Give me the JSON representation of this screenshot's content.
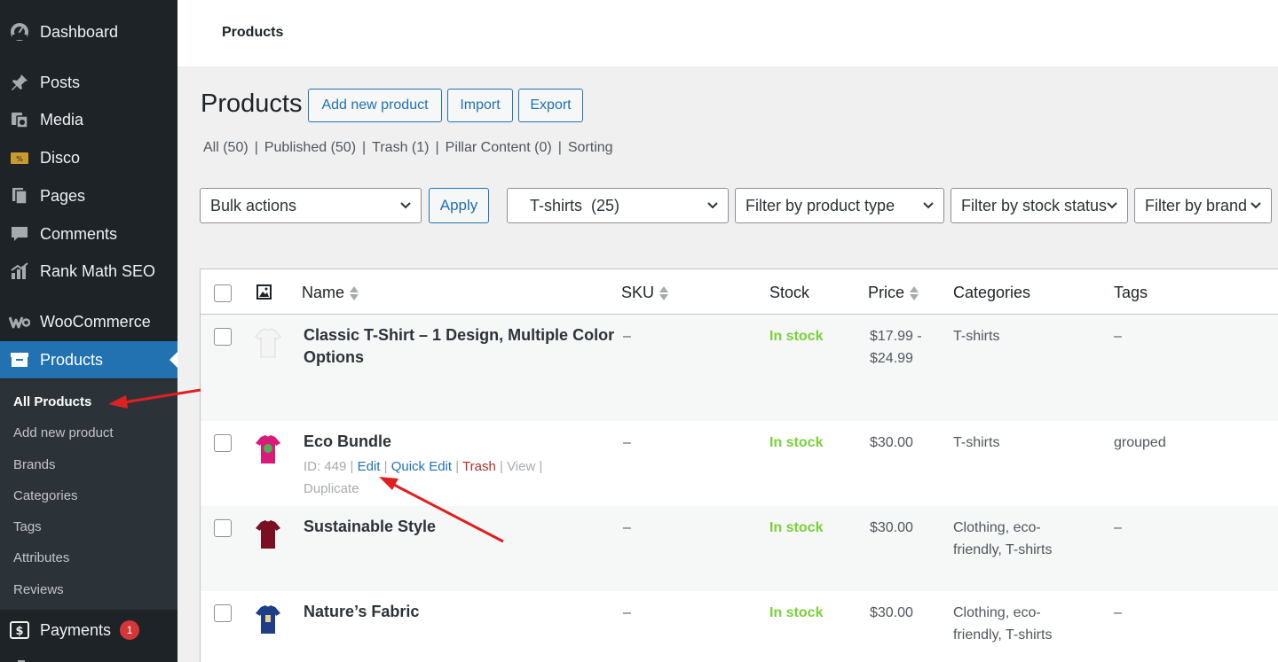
{
  "sidebar": {
    "menu": [
      {
        "label": "Dashboard",
        "icon": "dashboard-icon"
      },
      {
        "label": "Posts",
        "icon": "pin-icon"
      },
      {
        "label": "Media",
        "icon": "media-icon"
      },
      {
        "label": "Disco",
        "icon": "disco-icon"
      },
      {
        "label": "Pages",
        "icon": "pages-icon"
      },
      {
        "label": "Comments",
        "icon": "comment-icon"
      },
      {
        "label": "Rank Math SEO",
        "icon": "chart-icon"
      },
      {
        "label": "WooCommerce",
        "icon": "woo-icon"
      },
      {
        "label": "Products",
        "icon": "archive-icon"
      },
      {
        "label": "Payments",
        "icon": "dollar-icon",
        "badge": "1"
      }
    ],
    "submenu": [
      "All Products",
      "Add new product",
      "Brands",
      "Categories",
      "Tags",
      "Attributes",
      "Reviews"
    ]
  },
  "topbar": {
    "title": "Products"
  },
  "page": {
    "title": "Products",
    "buttons": {
      "add_new": "Add new product",
      "import": "Import",
      "export": "Export"
    },
    "views": [
      "All (50)",
      "Published (50)",
      "Trash (1)",
      "Pillar Content (0)",
      "Sorting"
    ]
  },
  "filters": {
    "bulk_actions": "Bulk actions",
    "apply": "Apply",
    "category": "T-shirts  (25)",
    "product_type": "Filter by product type",
    "stock_status": "Filter by stock status",
    "brand": "Filter by brand"
  },
  "table": {
    "columns": {
      "name": "Name",
      "sku": "SKU",
      "stock": "Stock",
      "price": "Price",
      "categories": "Categories",
      "tags": "Tags"
    },
    "rows": [
      {
        "name_line1": "Classic T-Shirt – 1 Design, Multiple Color",
        "name_line2": "Options",
        "sku": "–",
        "stock": "In stock",
        "price_line1": "$17.99 -",
        "price_line2": "$24.99",
        "cat_line1": "T-shirts",
        "cat_line2": "",
        "tags": "–",
        "shirt_color": "#f4f4f4"
      },
      {
        "name_line1": "Eco Bundle",
        "name_line2": "",
        "sku": "–",
        "stock": "In stock",
        "price_line1": "$30.00",
        "price_line2": "",
        "cat_line1": "T-shirts",
        "cat_line2": "",
        "tags": "grouped",
        "shirt_color": "#d81b7a",
        "actions": {
          "id": "ID: 449",
          "edit": "Edit",
          "quick_edit": "Quick Edit",
          "trash": "Trash",
          "view": "View",
          "duplicate": "Duplicate"
        }
      },
      {
        "name_line1": "Sustainable Style",
        "name_line2": "",
        "sku": "–",
        "stock": "In stock",
        "price_line1": "$30.00",
        "price_line2": "",
        "cat_line1": "Clothing, eco-",
        "cat_line2": "friendly, T-shirts",
        "tags": "–",
        "shirt_color": "#7a0f22"
      },
      {
        "name_line1": "Nature’s Fabric",
        "name_line2": "",
        "sku": "–",
        "stock": "In stock",
        "price_line1": "$30.00",
        "price_line2": "",
        "cat_line1": "Clothing, eco-",
        "cat_line2": "friendly, T-shirts",
        "tags": "–",
        "shirt_color": "#1f3e8a"
      }
    ]
  },
  "colors": {
    "sidebar_bg": "#1d2327",
    "accent": "#2271b1",
    "in_stock": "#7ad03a",
    "trash": "#b32d2e",
    "badge": "#d63638",
    "annotation_arrow": "#e02020"
  }
}
